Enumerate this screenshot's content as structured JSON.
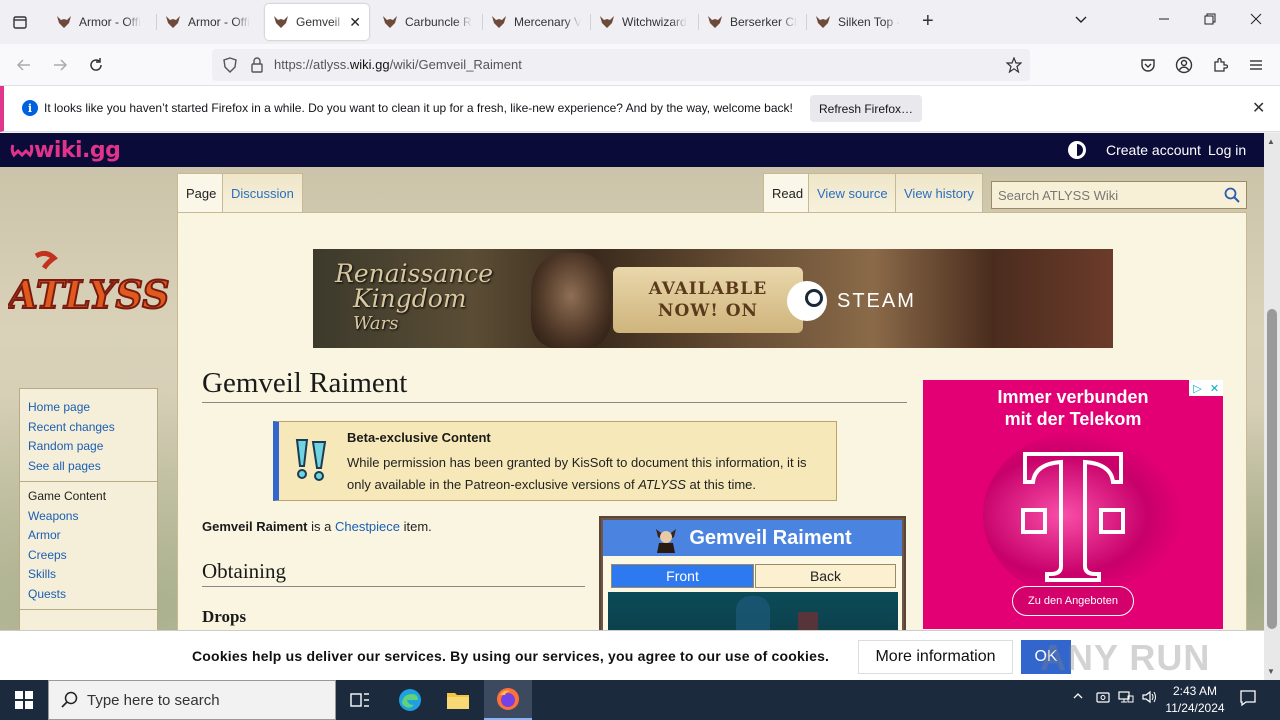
{
  "browser": {
    "tabs": [
      {
        "label": "Armor - Offi"
      },
      {
        "label": "Armor - Offi"
      },
      {
        "label": "Gemveil R"
      },
      {
        "label": "Carbuncle R"
      },
      {
        "label": "Mercenary V"
      },
      {
        "label": "Witchwizard"
      },
      {
        "label": "Berserker Ch"
      },
      {
        "label": "Silken Top -"
      }
    ],
    "url_prefix": "https://atlyss.",
    "url_domain": "wiki.gg",
    "url_path": "/wiki/Gemveil_Raiment"
  },
  "notification": {
    "message": "It looks like you haven’t started Firefox in a while. Do you want to clean it up for a fresh, like-new experience? And by the way, welcome back!",
    "button": "Refresh Firefox…"
  },
  "wikigg": {
    "logo": "wiki.gg",
    "create_account": "Create account",
    "log_in": "Log in"
  },
  "site_logo": "ATLYSS",
  "sidebar": {
    "nav": [
      "Home page",
      "Recent changes",
      "Random page",
      "See all pages"
    ],
    "content_heading": "Game Content",
    "content": [
      "Weapons",
      "Armor",
      "Creeps",
      "Skills",
      "Quests"
    ]
  },
  "page_tabs": {
    "page": "Page",
    "discussion": "Discussion",
    "read": "Read",
    "view_source": "View source",
    "view_history": "View history"
  },
  "search": {
    "placeholder": "Search ATLYSS Wiki"
  },
  "banner": {
    "title_line1": "Renaissance",
    "title_line2": "Kingdom",
    "title_line3": "Wars",
    "available_line1": "AVAILABLE",
    "available_line2": "NOW! ON",
    "steam": "STEAM"
  },
  "article": {
    "title": "Gemveil Raiment",
    "beta_heading": "Beta-exclusive Content",
    "beta_text_pre": "While permission has been granted by KisSoft to document this information, it is only available in the Patreon-exclusive versions of ",
    "beta_text_em": "ATLYSS",
    "beta_text_post": " at this time.",
    "intro_bold": "Gemveil Raiment",
    "intro_mid": " is a ",
    "intro_link": "Chestpiece",
    "intro_end": " item.",
    "h_obtaining": "Obtaining",
    "h_drops": "Drops"
  },
  "infobox": {
    "title": "Gemveil Raiment",
    "tab_front": "Front",
    "tab_back": "Back"
  },
  "ad": {
    "headline_1": "Immer verbunden",
    "headline_2": "mit der Telekom",
    "cta": "Zu den Angeboten"
  },
  "cookie": {
    "text": "Cookies help us deliver our services. By using our services, you agree to our use of cookies.",
    "more": "More information",
    "ok": "OK",
    "watermark": "ANY RUN"
  },
  "taskbar": {
    "search_placeholder": "Type here to search",
    "time": "2:43 AM",
    "date": "11/24/2024"
  },
  "colors": {
    "wikigg_bar": "#0b0b3a",
    "wikigg_brand": "#e0348a",
    "link": "#1a5fb4",
    "infobox_header": "#4b84e0",
    "telekom_magenta": "#e20074",
    "cookie_ok": "#3366cc"
  }
}
